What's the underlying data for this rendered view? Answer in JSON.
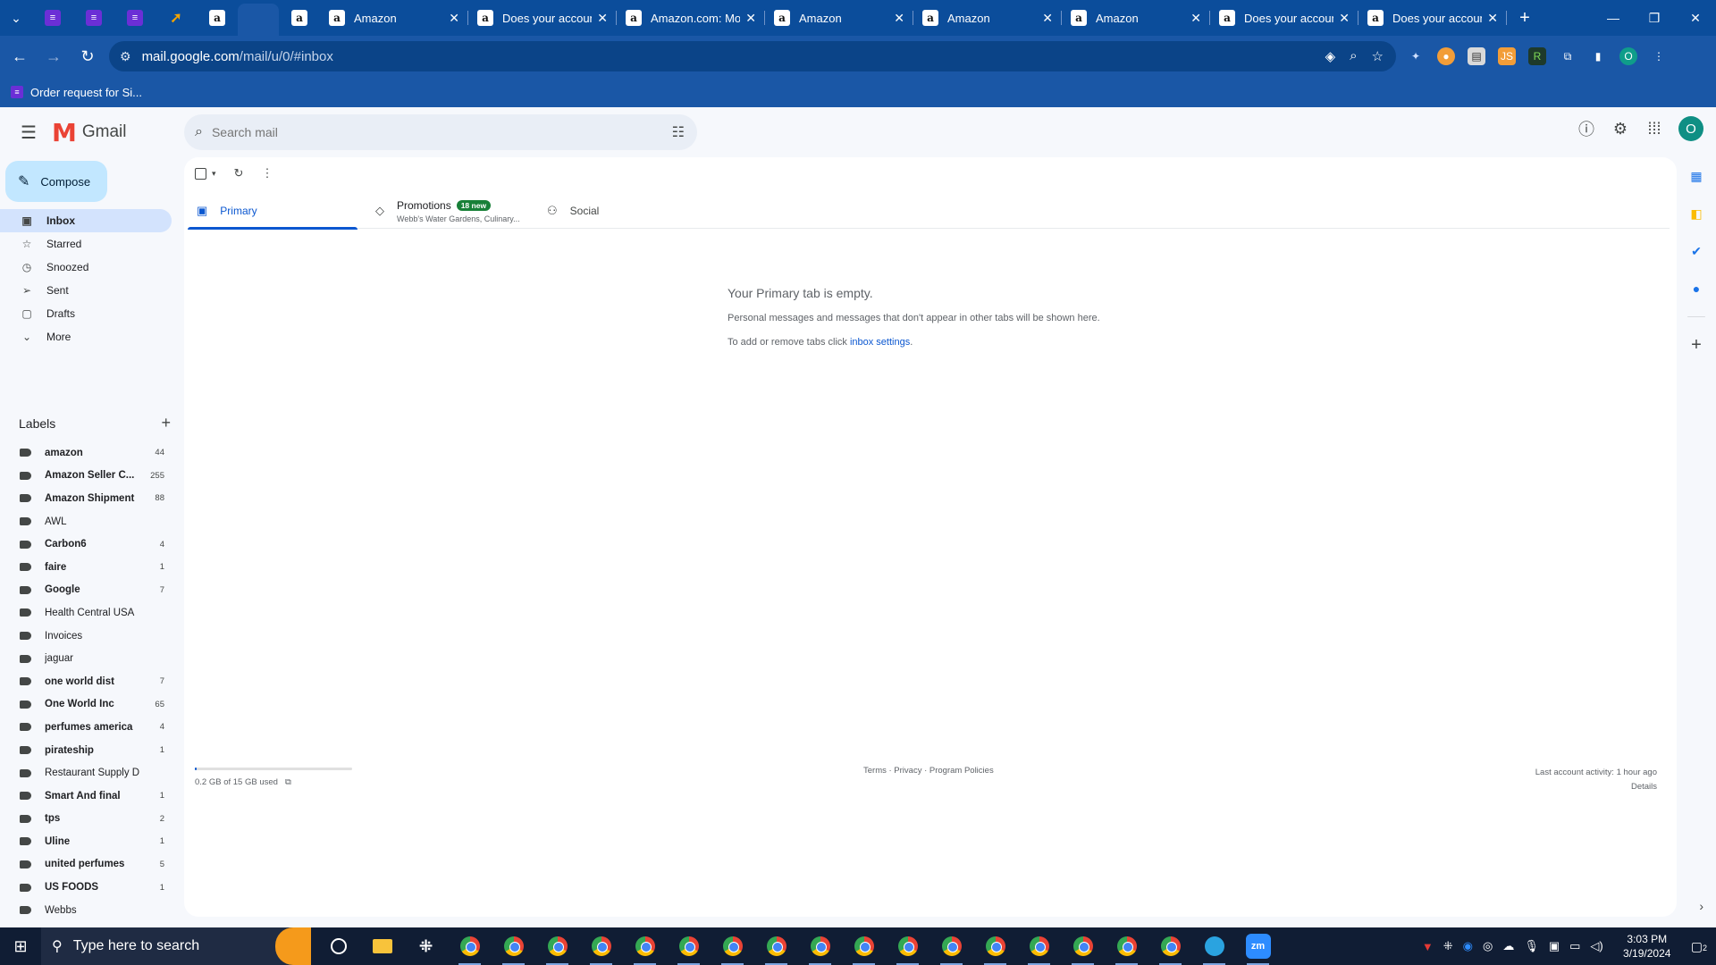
{
  "browser": {
    "tabs": [
      {
        "title": "Amazon"
      },
      {
        "title": "Does your accoun"
      },
      {
        "title": "Amazon.com: Mot"
      },
      {
        "title": "Amazon"
      },
      {
        "title": "Amazon"
      },
      {
        "title": "Amazon"
      },
      {
        "title": "Does your accoun"
      },
      {
        "title": "Does your accoun"
      }
    ],
    "url_host": "mail.google.com",
    "url_path": "/mail/u/0/#inbox",
    "bookmark": "Order request for Si...",
    "profile_initial": "O"
  },
  "gmail": {
    "brand": "Gmail",
    "search_placeholder": "Search mail",
    "compose_label": "Compose",
    "nav": [
      {
        "label": "Inbox",
        "icon": "inbox-icon"
      },
      {
        "label": "Starred",
        "icon": "star-icon"
      },
      {
        "label": "Snoozed",
        "icon": "clock-icon"
      },
      {
        "label": "Sent",
        "icon": "send-icon"
      },
      {
        "label": "Drafts",
        "icon": "draft-icon"
      },
      {
        "label": "More",
        "icon": "chevron-down-icon"
      }
    ],
    "labels_title": "Labels",
    "labels": [
      {
        "name": "amazon",
        "count": "44",
        "bold": true
      },
      {
        "name": "Amazon Seller C...",
        "count": "255",
        "bold": true
      },
      {
        "name": "Amazon Shipment",
        "count": "88",
        "bold": true
      },
      {
        "name": "AWL",
        "count": "",
        "bold": false
      },
      {
        "name": "Carbon6",
        "count": "4",
        "bold": true
      },
      {
        "name": "faire",
        "count": "1",
        "bold": true
      },
      {
        "name": "Google",
        "count": "7",
        "bold": true
      },
      {
        "name": "Health Central USA",
        "count": "",
        "bold": false
      },
      {
        "name": "Invoices",
        "count": "",
        "bold": false
      },
      {
        "name": "jaguar",
        "count": "",
        "bold": false
      },
      {
        "name": "one world dist",
        "count": "7",
        "bold": true
      },
      {
        "name": "One World Inc",
        "count": "65",
        "bold": true
      },
      {
        "name": "perfumes america",
        "count": "4",
        "bold": true
      },
      {
        "name": "pirateship",
        "count": "1",
        "bold": true
      },
      {
        "name": "Restaurant Supply D",
        "count": "",
        "bold": false
      },
      {
        "name": "Smart And final",
        "count": "1",
        "bold": true
      },
      {
        "name": "tps",
        "count": "2",
        "bold": true
      },
      {
        "name": "Uline",
        "count": "1",
        "bold": true
      },
      {
        "name": "united perfumes",
        "count": "5",
        "bold": true
      },
      {
        "name": "US FOODS",
        "count": "1",
        "bold": true
      },
      {
        "name": "Webbs",
        "count": "",
        "bold": false
      }
    ],
    "tabs": {
      "primary": "Primary",
      "promotions": "Promotions",
      "promotions_badge": "18 new",
      "promotions_sub": "Webb's Water Gardens, Culinary...",
      "social": "Social"
    },
    "empty": {
      "title": "Your Primary tab is empty.",
      "line1": "Personal messages and messages that don't appear in other tabs will be shown here.",
      "line2_prefix": "To add or remove tabs click ",
      "line2_link": "inbox settings",
      "line2_suffix": "."
    },
    "footer": {
      "storage": "0.2 GB of 15 GB used",
      "storage_fraction": 0.013,
      "links": "Terms · Privacy · Program Policies",
      "activity": "Last account activity: 1 hour ago",
      "details": "Details"
    },
    "account_initial": "O"
  },
  "taskbar": {
    "search_placeholder": "Type here to search",
    "time": "3:03 PM",
    "date": "3/19/2024",
    "zoom_label": "zm",
    "notifications": "2"
  }
}
